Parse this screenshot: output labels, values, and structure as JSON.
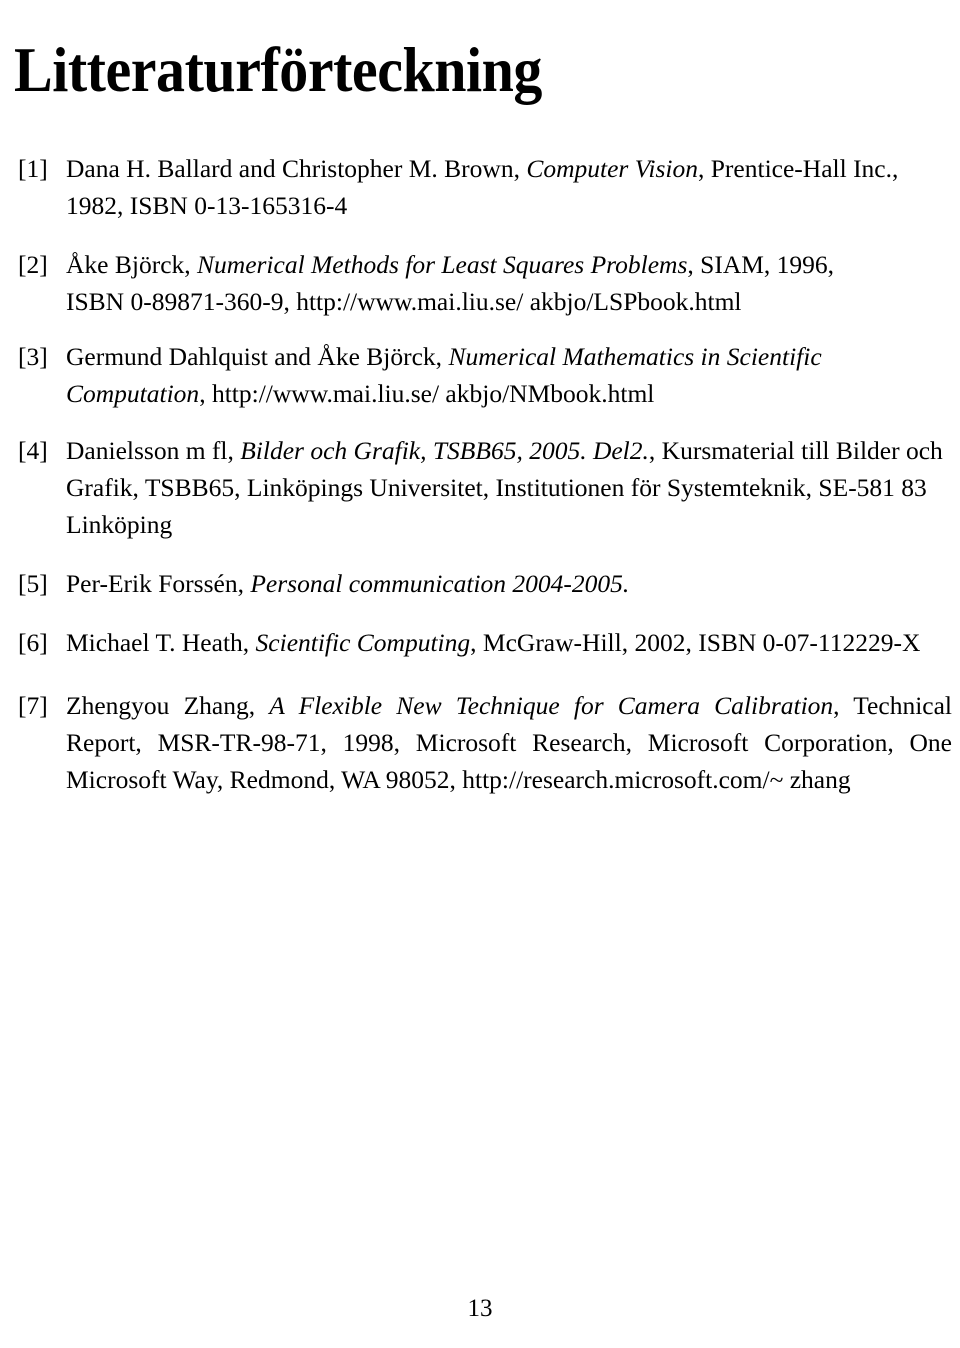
{
  "document": {
    "title": "Litteraturförteckning",
    "page_number": "13"
  },
  "bibliography": [
    {
      "label": "[1]",
      "authors": "Dana H. Ballard and Christopher M. Brown,",
      "work_title": "Computer Vision",
      "rest": ", Prentice-Hall Inc., 1982, ISBN 0-13-165316-4"
    },
    {
      "label": "[2]",
      "authors": "Åke Björck,",
      "work_title": "Numerical Methods for Least Squares Problems",
      "rest": ", SIAM, 1996, ISBN 0-89871-360-9, http://www.mai.liu.se/ akbjo/LSPbook.html"
    },
    {
      "label": "[3]",
      "authors": "Germund Dahlquist and Åke Björck,",
      "work_title": "Numerical Mathematics in Scientific Computation",
      "rest": ", http://www.mai.liu.se/ akbjo/NMbook.html"
    },
    {
      "label": "[4]",
      "authors": "Danielsson m fl,",
      "work_title": "Bilder och Grafik, TSBB65, 2005. Del2.",
      "rest": ", Kursmaterial till Bilder och Grafik, TSBB65, Linköpings Universitet, Institutionen för Systemteknik, SE-581 83 Linköping"
    },
    {
      "label": "[5]",
      "authors": "Per-Erik Forssén,",
      "work_title": "Personal communication 2004-2005.",
      "rest": ""
    },
    {
      "label": "[6]",
      "authors": "Michael T. Heath,",
      "work_title": "Scientific Computing",
      "rest": ", McGraw-Hill, 2002, ISBN 0-07-112229-X"
    },
    {
      "label": "[7]",
      "authors": "Zhengyou Zhang,",
      "work_title": "A Flexible New Technique for Camera Calibration",
      "rest": ", Technical Report, MSR-TR-98-71, 1998, Microsoft Research, Microsoft Corporation, One Microsoft Way, Redmond, WA 98052, http://research.microsoft.com/~ zhang"
    }
  ]
}
